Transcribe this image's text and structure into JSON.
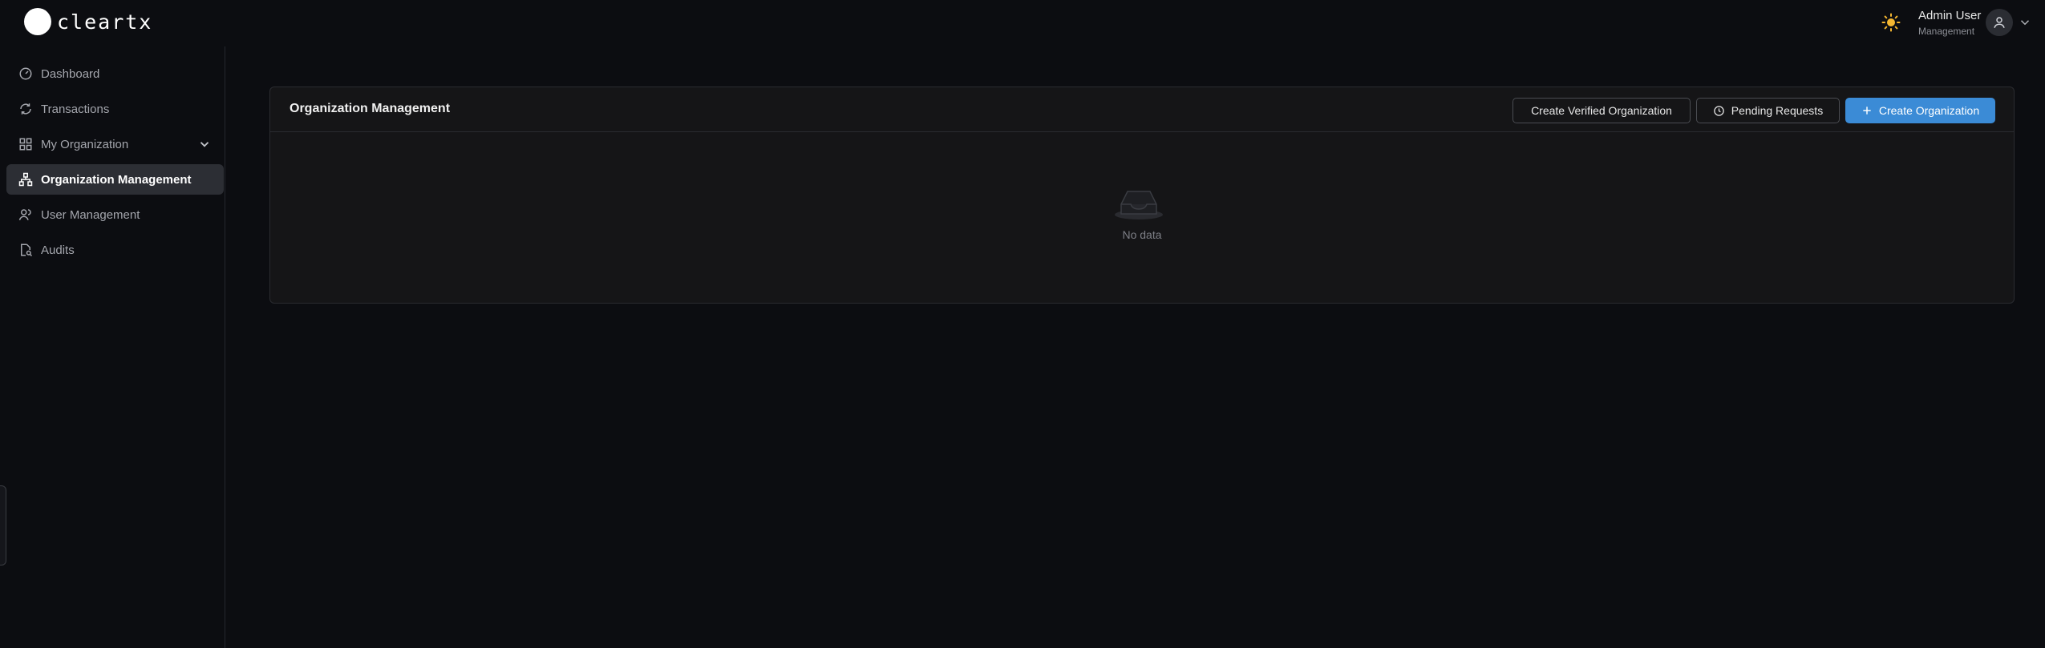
{
  "app": {
    "logo_text": "cleartx"
  },
  "header": {
    "user_name": "Admin User",
    "user_role": "Management",
    "icons": [
      "sun-icon",
      "user-avatar-icon",
      "chevron-down-icon"
    ]
  },
  "sidebar": {
    "items": [
      {
        "label": "Dashboard",
        "icon": "dashboard-icon"
      },
      {
        "label": "Transactions",
        "icon": "transactions-icon"
      },
      {
        "label": "My Organization",
        "icon": "grid-icon"
      },
      {
        "label": "Organization Management",
        "icon": "org-tree-icon",
        "active": true
      },
      {
        "label": "User Management",
        "icon": "users-icon"
      },
      {
        "label": "Audits",
        "icon": "audit-icon"
      }
    ]
  },
  "main": {
    "card_title": "Organization Management",
    "buttons": {
      "verified": "Create Verified Organization",
      "pending": "Pending Requests",
      "create": "Create Organization"
    },
    "empty_text": "No data"
  },
  "colors": {
    "background": "#0c0d11",
    "card": "#151517",
    "primary": "#3b8bd6",
    "active_nav": "#2c2e34",
    "sun": "#f5b731"
  }
}
